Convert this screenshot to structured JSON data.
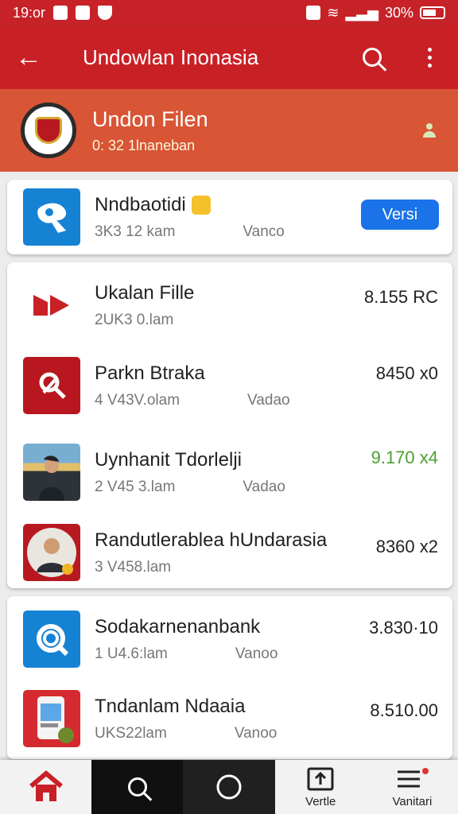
{
  "status": {
    "time": "19:or",
    "battery": "30%"
  },
  "app_bar": {
    "title": "Undowlan Inonasia",
    "back_icon": "arrow-left-icon",
    "search_icon": "search-icon",
    "menu_icon": "more-vertical-icon"
  },
  "profile": {
    "title": "Undon Filen",
    "subtitle": "0: 32 1lnaneban",
    "avatar_icon": "garuda-emblem-icon",
    "action_icon": "person-icon"
  },
  "featured": {
    "title": "Nndbaotidi",
    "meta": "3K3 12 kam",
    "secondary": "Vanco",
    "button": "Versi",
    "icon": "map-pin-icon"
  },
  "items": [
    {
      "title": "Ukalan Fille",
      "meta": "2UK3 0.lam",
      "secondary": "",
      "value": "8.155 RC",
      "icon": "arrow-play-icon"
    },
    {
      "title": "Parkn Btraka",
      "meta": "4 V43V.olam",
      "secondary": "Vadao",
      "value": "8450 x0",
      "icon": "magnifier-icon"
    },
    {
      "title": "Uynhanit Tdorlelji",
      "meta": "2 V45 3.lam",
      "secondary": "Vadao",
      "value": "9.170 x4",
      "icon": "person-photo-icon"
    },
    {
      "title": "Randutlerablea hUndarasia",
      "meta": "3 V458.lam",
      "secondary": "",
      "value": "8360 x2",
      "icon": "portrait-icon"
    }
  ],
  "lower_items": [
    {
      "title": "Sodakarnenanbank",
      "meta": "1 U4.6:lam",
      "secondary": "Vanoo",
      "value": "3.830·10",
      "icon": "search-gear-icon"
    },
    {
      "title": "Tndanlam Ndaaia",
      "meta": "UKS22lam",
      "secondary": "Vanoo",
      "value": "8.510.00",
      "icon": "phone-app-icon"
    }
  ],
  "bottom_nav": [
    {
      "label": "",
      "icon": "home-icon"
    },
    {
      "label": "",
      "icon": "search-icon"
    },
    {
      "label": "",
      "icon": "circle-icon"
    },
    {
      "label": "Vertle",
      "icon": "upload-icon"
    },
    {
      "label": "Vanitari",
      "icon": "menu-icon"
    }
  ],
  "colors": {
    "primary": "#c92026",
    "accent": "#1a73e8",
    "profile": "#d85535"
  }
}
